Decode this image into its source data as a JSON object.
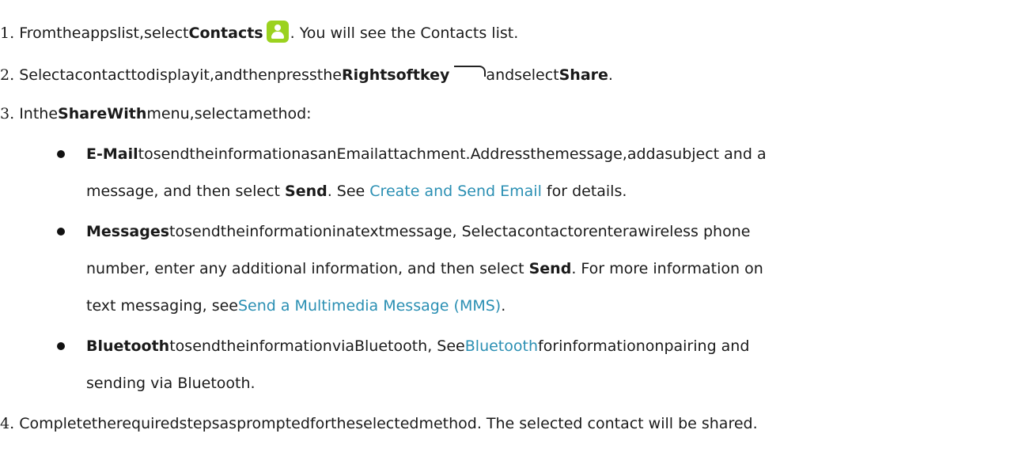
{
  "steps": [
    {
      "number": "1.",
      "parts": [
        "Fromtheappslist,select",
        "Contacts",
        ". You will see the Contacts list."
      ],
      "icon": "contacts-app-icon"
    },
    {
      "number": "2.",
      "parts": [
        "Selectacontacttodisplayit,andthenpressthe",
        "Rightsoftkey",
        "andselect",
        "Share",
        "."
      ],
      "icon": "right-softkey-icon"
    },
    {
      "number": "3.",
      "parts": [
        "Inthe",
        "ShareWith",
        "menu,selectamethod:"
      ]
    },
    {
      "number": "4.",
      "parts": [
        "Completetherequiredstepsaspromptedfortheselectedmethod.",
        " The selected contact will be shared."
      ]
    }
  ],
  "methods": [
    {
      "name": "E-Mail",
      "line1": "tosendtheinformationasanEmailattachment.Addressthemessage,addasubject and a",
      "line2_a": "message, and then select ",
      "line2_b": "Send",
      "line2_c": ". See ",
      "link": "Create and Send Email",
      "line2_d": " for details."
    },
    {
      "name": "Messages",
      "line1": "tosendtheinformationinatextmessage, Selectacontactorenterawireless phone",
      "line2_a": "number, enter any additional information, and then select ",
      "line2_b": "Send",
      "line2_c": ". For more information on",
      "line3_a": "text messaging, see",
      "link": "Send a Multimedia Message (MMS)",
      "line3_b": "."
    },
    {
      "name": "Bluetooth",
      "line1_a": "tosendtheinformationviaBluetooth, See",
      "link": "Bluetooth",
      "line1_b": "forinformationonpairing and",
      "line2": "sending via Bluetooth."
    }
  ],
  "colors": {
    "link": "#2a8fb3",
    "contacts_icon": "#9bd21f",
    "text": "#1a1a1a"
  }
}
